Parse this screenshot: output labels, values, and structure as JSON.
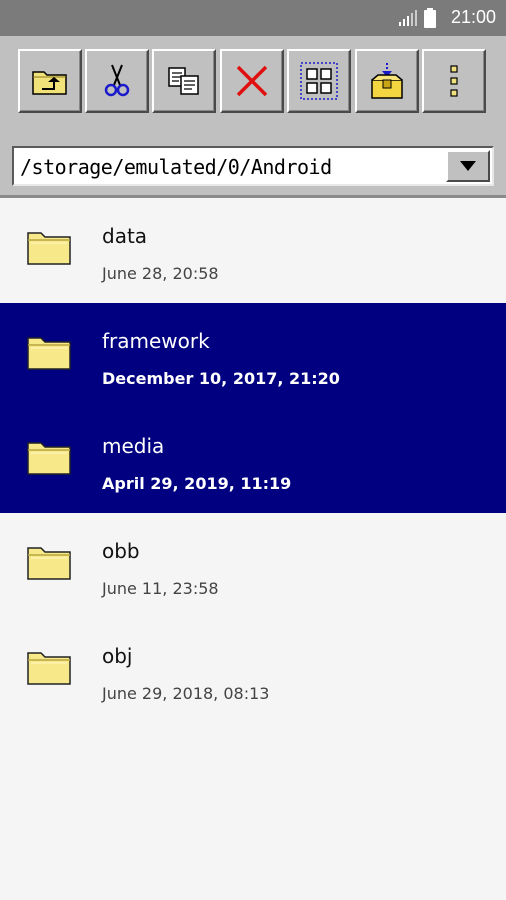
{
  "status_bar": {
    "time": "21:00",
    "icons": [
      "signal-icon",
      "battery-icon"
    ]
  },
  "toolbar": {
    "buttons": [
      {
        "name": "up-folder-button",
        "icon": "folder-up-icon"
      },
      {
        "name": "cut-button",
        "icon": "scissors-icon"
      },
      {
        "name": "copy-button",
        "icon": "copy-icon"
      },
      {
        "name": "delete-button",
        "icon": "delete-x-icon"
      },
      {
        "name": "select-all-button",
        "icon": "select-grid-icon"
      },
      {
        "name": "paste-button",
        "icon": "paste-box-icon"
      },
      {
        "name": "more-button",
        "icon": "more-vert-icon"
      }
    ]
  },
  "path": {
    "value": "/storage/emulated/0/Android"
  },
  "files": [
    {
      "name": "data",
      "date": "June 28, 20:58",
      "selected": false
    },
    {
      "name": "framework",
      "date": "December 10, 2017, 21:20",
      "selected": true
    },
    {
      "name": "media",
      "date": "April 29, 2019, 11:19",
      "selected": true
    },
    {
      "name": "obb",
      "date": "June 11, 23:58",
      "selected": false
    },
    {
      "name": "obj",
      "date": "June 29, 2018, 08:13",
      "selected": false
    }
  ],
  "colors": {
    "selection": "#000080",
    "toolbar": "#c0c0c0",
    "folder": "#f7e98a"
  }
}
